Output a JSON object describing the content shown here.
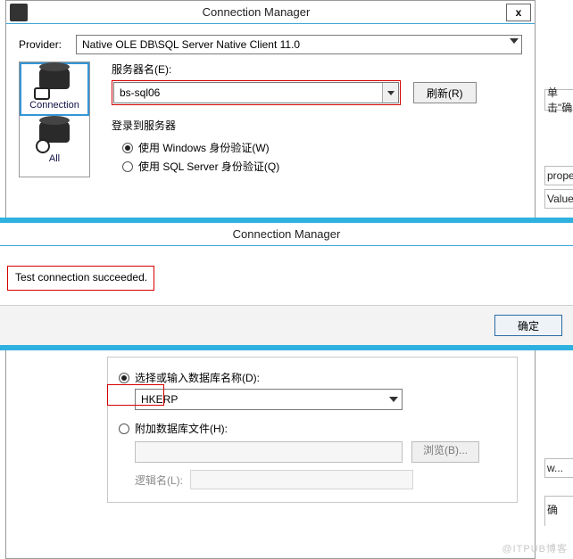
{
  "dialog": {
    "title": "Connection Manager",
    "close": "x"
  },
  "provider": {
    "label": "Provider:",
    "value": "Native OLE DB\\SQL Server Native Client 11.0"
  },
  "sidebar": {
    "items": [
      {
        "label": "Connection"
      },
      {
        "label": "All"
      }
    ]
  },
  "server": {
    "label": "服务器名(E):",
    "value": "bs-sql06",
    "refresh": "刷新(R)"
  },
  "auth": {
    "group": "登录到服务器",
    "win": "使用 Windows 身份验证(W)",
    "sql": "使用 SQL Server 身份验证(Q)"
  },
  "popup": {
    "title": "Connection Manager",
    "message": "Test connection succeeded.",
    "ok": "确定"
  },
  "db": {
    "selectLabel": "选择或输入数据库名称(D):",
    "value": "HKERP",
    "attachLabel": "附加数据库文件(H):",
    "browse": "浏览(B)...",
    "logical": "逻辑名(L):"
  },
  "right": {
    "f1": "单击\"确",
    "f2": "prope",
    "f3": "Value",
    "f4": "w...",
    "f5": "确"
  },
  "watermark": "@ITPUB博客"
}
